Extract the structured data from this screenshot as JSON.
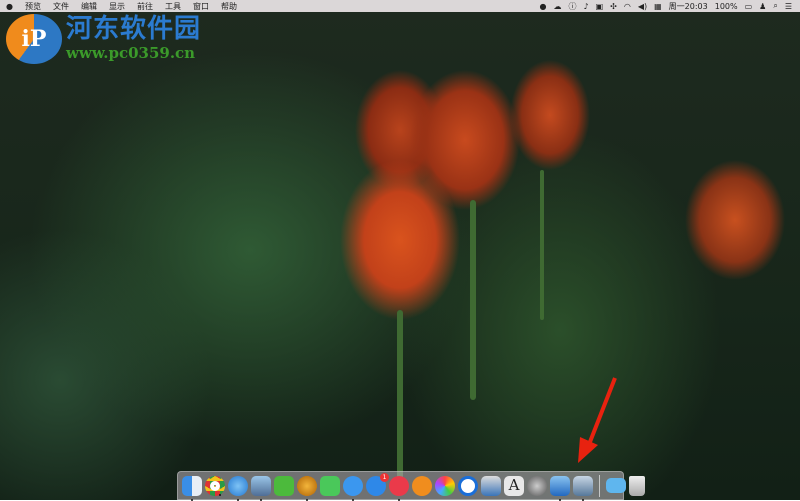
{
  "menubar": {
    "apple": "",
    "items": [
      "预览",
      "文件",
      "编辑",
      "显示",
      "前往",
      "工具",
      "窗口",
      "帮助"
    ],
    "clock": "周一20:03",
    "battery": "100%"
  },
  "watermark": {
    "site_name": "河东软件园",
    "url": "www.pc0359.cn"
  },
  "dock": {
    "items": [
      "finder",
      "chrome",
      "safari",
      "preview",
      "xmind",
      "tes",
      "facetime",
      "messages",
      "app-store",
      "itunes",
      "ibooks",
      "photos",
      "1password",
      "image-capture",
      "font-book",
      "system-preferences",
      "migration-bird",
      "photo-viewer"
    ],
    "app_store_badge": "1",
    "stack_items": [
      "folder",
      "trash"
    ]
  },
  "colors": {
    "annotation_arrow": "#e8220f"
  }
}
